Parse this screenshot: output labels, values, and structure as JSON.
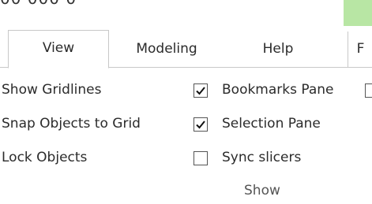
{
  "top_cut_text": "00 000 0",
  "tabs": [
    {
      "label": "View",
      "active": true
    },
    {
      "label": "Modeling",
      "active": false
    },
    {
      "label": "Help",
      "active": false
    },
    {
      "label": "F",
      "active": false
    }
  ],
  "left_options": [
    {
      "label": "Show Gridlines",
      "checked": true
    },
    {
      "label": "Snap Objects to Grid",
      "checked": true
    },
    {
      "label": "Lock Objects",
      "checked": false
    }
  ],
  "right_options": [
    {
      "label": "Bookmarks Pane",
      "checked": false
    },
    {
      "label": "Selection Pane",
      "checked": false
    },
    {
      "label": "Sync slicers",
      "checked": false
    }
  ],
  "group_label": "Show",
  "colors": {
    "accent_green": "#b8e6a4",
    "border": "#c8c8c8",
    "text": "#2b2b2b"
  }
}
